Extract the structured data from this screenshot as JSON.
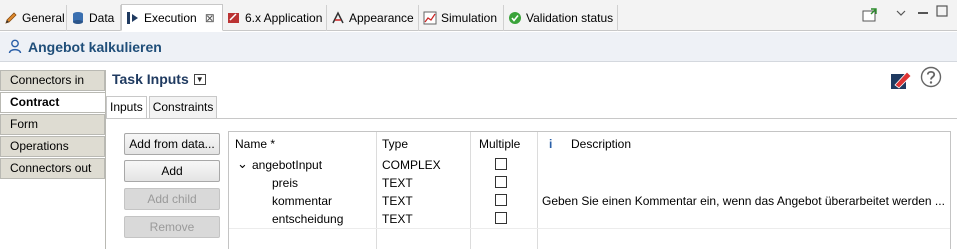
{
  "tabs": [
    {
      "label": "General",
      "icon": "pencil-icon"
    },
    {
      "label": "Data",
      "icon": "database-icon"
    },
    {
      "label": "Execution",
      "icon": "execution-icon",
      "active": true
    },
    {
      "label": "6.x Application",
      "icon": "application-icon"
    },
    {
      "label": "Appearance",
      "icon": "appearance-icon"
    },
    {
      "label": "Simulation",
      "icon": "chart-icon"
    },
    {
      "label": "Validation status",
      "icon": "check-circle-icon"
    }
  ],
  "close_glyph": "⊠",
  "title": "Angebot kalkulieren",
  "nav": {
    "items": [
      {
        "label": "Connectors in"
      },
      {
        "label": "Contract",
        "active": true
      },
      {
        "label": "Form"
      },
      {
        "label": "Operations"
      },
      {
        "label": "Connectors out"
      }
    ]
  },
  "section_title": "Task Inputs",
  "subtabs": [
    {
      "label": "Inputs",
      "active": true
    },
    {
      "label": "Constraints"
    }
  ],
  "buttons": {
    "add_from_data": "Add from data...",
    "add": "Add",
    "add_child": "Add child",
    "remove": "Remove"
  },
  "table": {
    "headers": {
      "name": "Name *",
      "type": "Type",
      "multiple": "Multiple",
      "info": "i",
      "description": "Description"
    },
    "rows": [
      {
        "expander": "⌄",
        "name": "angebotInput",
        "type": "COMPLEX",
        "multiple": false,
        "description": ""
      },
      {
        "name": "preis",
        "type": "TEXT",
        "multiple": false,
        "description": ""
      },
      {
        "name": "kommentar",
        "type": "TEXT",
        "multiple": false,
        "description": "Geben Sie einen Kommentar ein, wenn das Angebot überarbeitet werden ..."
      },
      {
        "name": "entscheidung",
        "type": "TEXT",
        "multiple": false,
        "description": ""
      }
    ]
  },
  "colors": {
    "title_text": "#1f4e79",
    "nav_bg": "#dedcd2",
    "info_blue": "#2a5fa8"
  }
}
